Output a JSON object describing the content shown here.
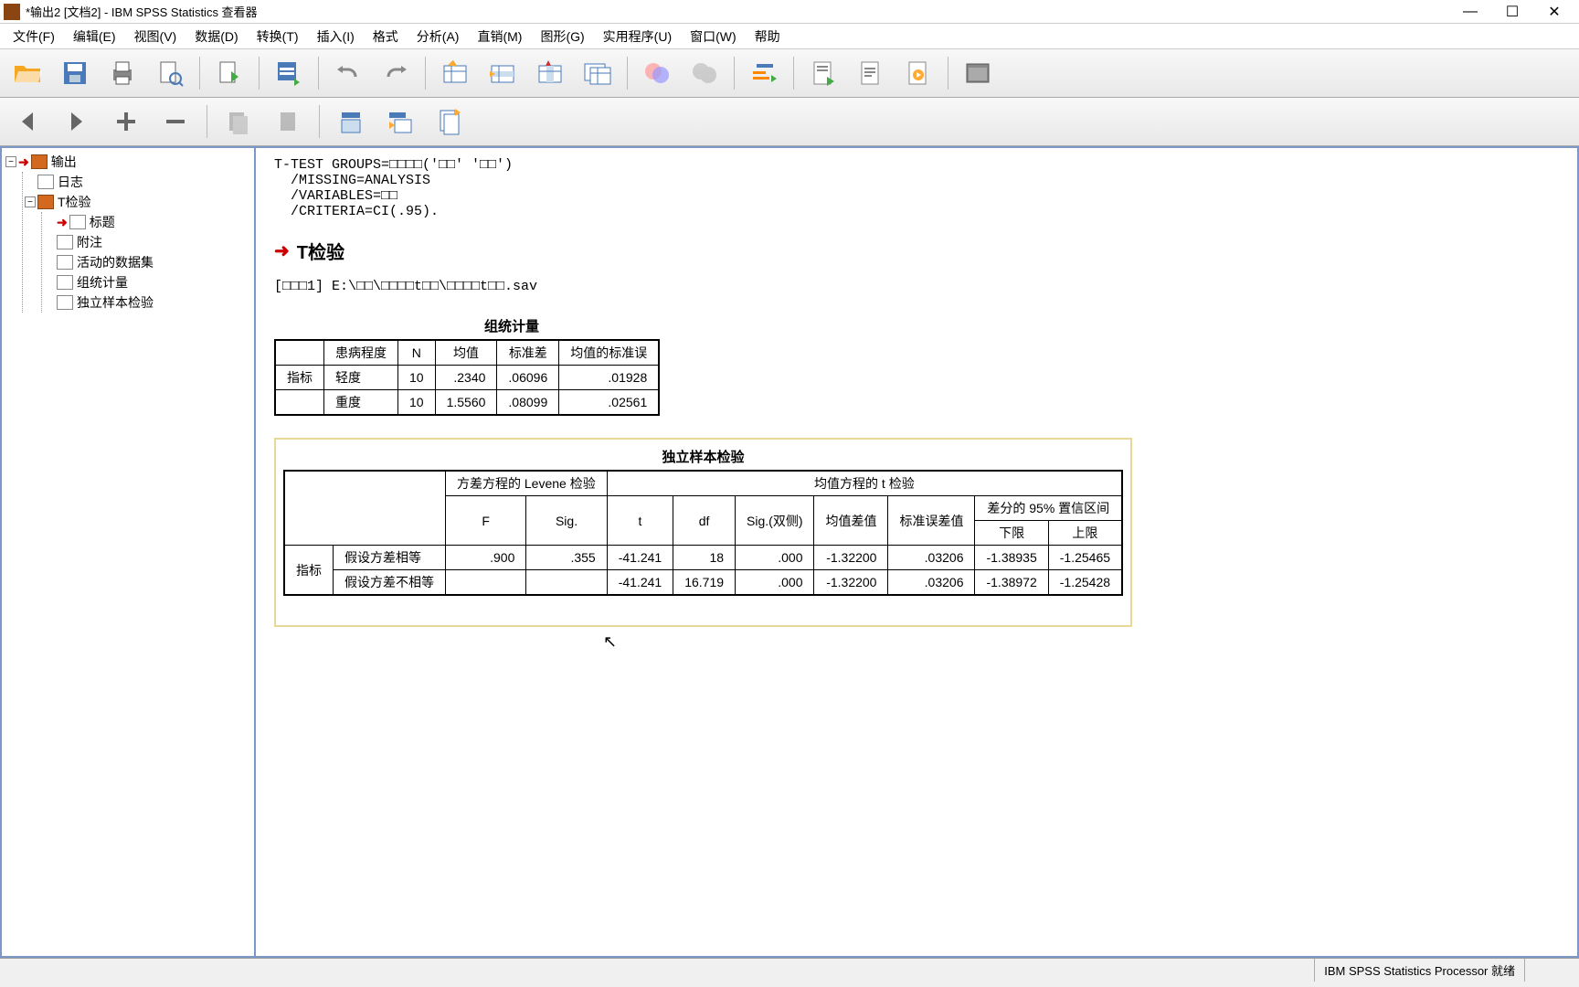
{
  "window": {
    "title": "*输出2 [文档2] - IBM SPSS Statistics 查看器"
  },
  "menu": {
    "file": "文件(F)",
    "edit": "编辑(E)",
    "view": "视图(V)",
    "data": "数据(D)",
    "transform": "转换(T)",
    "insert": "插入(I)",
    "format": "格式",
    "analyze": "分析(A)",
    "direct": "直销(M)",
    "graphs": "图形(G)",
    "utilities": "实用程序(U)",
    "window": "窗口(W)",
    "help": "帮助"
  },
  "outline": {
    "root": "输出",
    "log": "日志",
    "ttest": "T检验",
    "children": [
      "标题",
      "附注",
      "活动的数据集",
      "组统计量",
      "独立样本检验"
    ]
  },
  "syntax": "T-TEST GROUPS=□□□□('□□' '□□')\n  /MISSING=ANALYSIS\n  /VARIABLES=□□\n  /CRITERIA=CI(.95).",
  "section_title": "T检验",
  "dataset_line": "[□□□1] E:\\□□\\□□□□t□□\\□□□□t□□.sav",
  "table1": {
    "title": "组统计量",
    "headers": [
      "患病程度",
      "N",
      "均值",
      "标准差",
      "均值的标准误"
    ],
    "rowlabel": "指标",
    "rows": [
      {
        "grp": "轻度",
        "n": "10",
        "mean": ".2340",
        "sd": ".06096",
        "se": ".01928"
      },
      {
        "grp": "重度",
        "n": "10",
        "mean": "1.5560",
        "sd": ".08099",
        "se": ".02561"
      }
    ]
  },
  "table2": {
    "title": "独立样本检验",
    "levene_header": "方差方程的 Levene 检验",
    "ttest_header": "均值方程的 t 检验",
    "ci_header": "差分的 95% 置信区间",
    "cols": {
      "F": "F",
      "Sig": "Sig.",
      "t": "t",
      "df": "df",
      "Sig2": "Sig.(双侧)",
      "meandiff": "均值差值",
      "sediff": "标准误差值",
      "lower": "下限",
      "upper": "上限"
    },
    "rowlabel": "指标",
    "rows": [
      {
        "assume": "假设方差相等",
        "F": ".900",
        "Sig": ".355",
        "t": "-41.241",
        "df": "18",
        "Sig2": ".000",
        "meandiff": "-1.32200",
        "sediff": ".03206",
        "lower": "-1.38935",
        "upper": "-1.25465"
      },
      {
        "assume": "假设方差不相等",
        "F": "",
        "Sig": "",
        "t": "-41.241",
        "df": "16.719",
        "Sig2": ".000",
        "meandiff": "-1.32200",
        "sediff": ".03206",
        "lower": "-1.38972",
        "upper": "-1.25428"
      }
    ]
  },
  "status": {
    "processor": "IBM SPSS Statistics Processor 就绪"
  }
}
